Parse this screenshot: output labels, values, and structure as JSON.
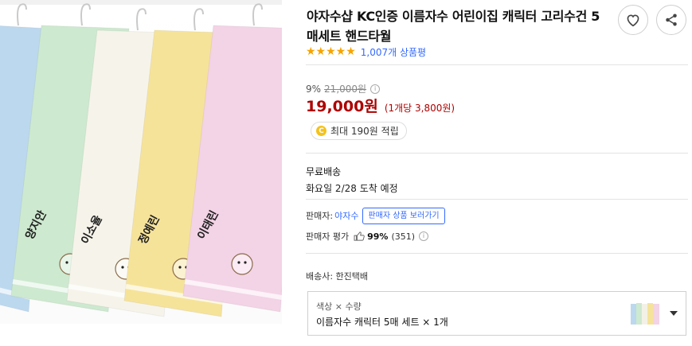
{
  "product": {
    "title": "야자수샵 KC인증 이름자수 어린이집 캐릭터 고리수건 5매세트 핸드타월",
    "image_alt": "이름자수 캐릭터 손수건 5매 세트",
    "towels": [
      {
        "color": "#bcd8ee",
        "name": ""
      },
      {
        "color": "#cde9cf",
        "name": "양지안"
      },
      {
        "color": "#f6f4ea",
        "name": "이소율"
      },
      {
        "color": "#f6e39a",
        "name": "정예린"
      },
      {
        "color": "#f3d3e6",
        "name": "이태린"
      }
    ]
  },
  "actions": {
    "wishlist_icon": "heart-icon",
    "share_icon": "share-icon"
  },
  "rating": {
    "stars": "★★★★★",
    "review_count": "1,007개 상품평"
  },
  "price": {
    "discount_rate": "9%",
    "original": "21,000원",
    "sale": "19,000원",
    "unit": "(1개당 3,800원)",
    "points": "최대 190원 적립",
    "coin_symbol": "C"
  },
  "shipping": {
    "title": "무료배송",
    "eta": "화요일 2/28 도착 예정"
  },
  "seller": {
    "label": "판매자:",
    "name": "야자수",
    "view_button": "판매자 상품 보러가기",
    "rating_label": "판매자 평가",
    "rating_percent": "99%",
    "rating_count": "(351)"
  },
  "courier": "배송사: 한진택배",
  "option": {
    "label": "색상 × 수량",
    "value": "이름자수 캐릭터 5매 세트 × 1개"
  },
  "colors": {
    "accent": "#346aff",
    "price": "#ae0000",
    "star": "#f5a400"
  }
}
